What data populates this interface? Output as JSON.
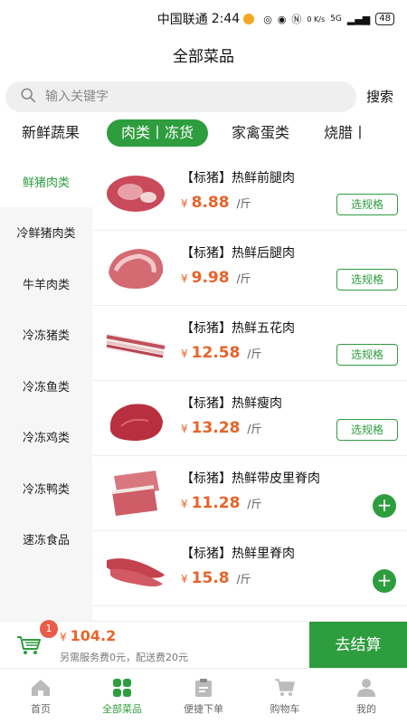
{
  "status_bar": {
    "carrier": "中国联通",
    "time": "2:44",
    "network_speed": "0 K/s",
    "signal": "5G",
    "battery": "48"
  },
  "header": {
    "title": "全部菜品"
  },
  "search": {
    "placeholder": "输入关键字",
    "button_label": "搜索"
  },
  "category_tabs": [
    "新鲜蔬果",
    "肉类丨冻货",
    "家禽蛋类",
    "烧腊丨"
  ],
  "active_category": "肉类丨冻货",
  "sidebar": {
    "items": [
      "鲜猪肉类",
      "冷鲜猪肉类",
      "牛羊肉类",
      "冷冻猪类",
      "冷冻鱼类",
      "冷冻鸡类",
      "冷冻鸭类",
      "速冻食品"
    ],
    "active": "鲜猪肉类"
  },
  "products": [
    {
      "name": "【标猪】热鲜前腿肉",
      "yen": "¥",
      "price": "8.88",
      "unit": "/斤",
      "action": "选规格",
      "icon": "pork-shoulder-image"
    },
    {
      "name": "【标猪】热鲜后腿肉",
      "yen": "¥",
      "price": "9.98",
      "unit": "/斤",
      "action": "选规格",
      "icon": "pork-leg-image"
    },
    {
      "name": "【标猪】热鲜五花肉",
      "yen": "¥",
      "price": "12.58",
      "unit": "/斤",
      "action": "选规格",
      "icon": "pork-belly-image"
    },
    {
      "name": "【标猪】热鲜瘦肉",
      "yen": "¥",
      "price": "13.28",
      "unit": "/斤",
      "action": "选规格",
      "icon": "lean-pork-image"
    },
    {
      "name": "【标猪】热鲜带皮里脊肉",
      "yen": "¥",
      "price": "11.28",
      "unit": "/斤",
      "action": "+",
      "icon": "pork-loin-skin-image"
    },
    {
      "name": "【标猪】热鲜里脊肉",
      "yen": "¥",
      "price": "15.8",
      "unit": "/斤",
      "action": "+",
      "icon": "pork-tenderloin-image"
    }
  ],
  "cart": {
    "badge": "1",
    "yen": "¥",
    "total": "104.2",
    "fee_note": "另需服务费0元，配送费20元",
    "checkout_label": "去结算",
    "icon": "cart-icon"
  },
  "tabbar": {
    "items": [
      {
        "label": "首页",
        "icon": "home-icon"
      },
      {
        "label": "全部菜品",
        "icon": "grid-icon"
      },
      {
        "label": "便捷下单",
        "icon": "clipboard-icon"
      },
      {
        "label": "购物车",
        "icon": "cart-icon"
      },
      {
        "label": "我的",
        "icon": "user-icon"
      }
    ],
    "active": "全部菜品"
  },
  "colors": {
    "accent": "#2e9d3e",
    "price": "#e8632a",
    "badge": "#e85c4a"
  }
}
